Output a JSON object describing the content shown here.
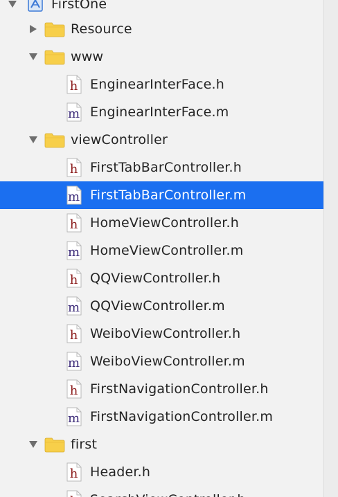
{
  "navigator": {
    "project": {
      "label": "FirstOne",
      "icon": "xcode-project-icon"
    },
    "rows": [
      {
        "kind": "folder",
        "label": "Resource",
        "expanded": false,
        "depth": 0
      },
      {
        "kind": "folder",
        "label": "www",
        "expanded": true,
        "depth": 0
      },
      {
        "kind": "h",
        "label": "EnginearInterFace.h",
        "depth": 1
      },
      {
        "kind": "m",
        "label": "EnginearInterFace.m",
        "depth": 1
      },
      {
        "kind": "folder",
        "label": "viewController",
        "expanded": true,
        "depth": 0
      },
      {
        "kind": "h",
        "label": "FirstTabBarController.h",
        "depth": 1
      },
      {
        "kind": "m",
        "label": "FirstTabBarController.m",
        "depth": 1,
        "selected": true
      },
      {
        "kind": "h",
        "label": "HomeViewController.h",
        "depth": 1
      },
      {
        "kind": "m",
        "label": "HomeViewController.m",
        "depth": 1
      },
      {
        "kind": "h",
        "label": "QQViewController.h",
        "depth": 1
      },
      {
        "kind": "m",
        "label": "QQViewController.m",
        "depth": 1
      },
      {
        "kind": "h",
        "label": "WeiboViewController.h",
        "depth": 1
      },
      {
        "kind": "m",
        "label": "WeiboViewController.m",
        "depth": 1
      },
      {
        "kind": "h",
        "label": "FirstNavigationController.h",
        "depth": 1
      },
      {
        "kind": "m",
        "label": "FirstNavigationController.m",
        "depth": 1
      },
      {
        "kind": "folder",
        "label": "first",
        "expanded": true,
        "depth": 0
      },
      {
        "kind": "h",
        "label": "Header.h",
        "depth": 1
      },
      {
        "kind": "h",
        "label": "SearchViewController.h",
        "depth": 1
      }
    ]
  },
  "colors": {
    "selection": "#1b6ff0",
    "folder": "#f7cf4a",
    "h_glyph": "#8b1a1a",
    "m_glyph": "#3b2a78"
  }
}
